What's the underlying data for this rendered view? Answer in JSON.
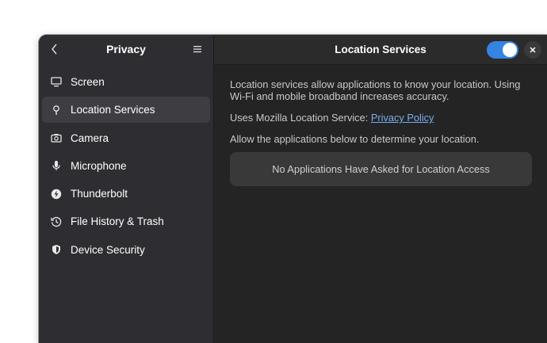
{
  "sidebar": {
    "title": "Privacy",
    "back_icon": "chevron-left-icon",
    "menu_icon": "hamburger-menu-icon",
    "items": [
      {
        "label": "Screen",
        "icon": "monitor-icon"
      },
      {
        "label": "Location Services",
        "icon": "location-pin-icon",
        "active": true
      },
      {
        "label": "Camera",
        "icon": "camera-icon"
      },
      {
        "label": "Microphone",
        "icon": "microphone-icon"
      },
      {
        "label": "Thunderbolt",
        "icon": "thunderbolt-icon"
      },
      {
        "label": "File History & Trash",
        "icon": "history-icon"
      },
      {
        "label": "Device Security",
        "icon": "shield-icon"
      }
    ]
  },
  "content": {
    "title": "Location Services",
    "toggle_on": true,
    "description": "Location services allow applications to know your location. Using Wi-Fi and mobile broadband increases accuracy.",
    "service_prefix": "Uses Mozilla Location Service: ",
    "policy_link": "Privacy Policy",
    "apps_intro": "Allow the applications below to determine your location.",
    "empty_message": "No Applications Have Asked for Location Access"
  },
  "colors": {
    "accent": "#3584e4",
    "link": "#78aeed",
    "sidebar_bg": "#2e2e32",
    "content_bg": "#242424"
  }
}
